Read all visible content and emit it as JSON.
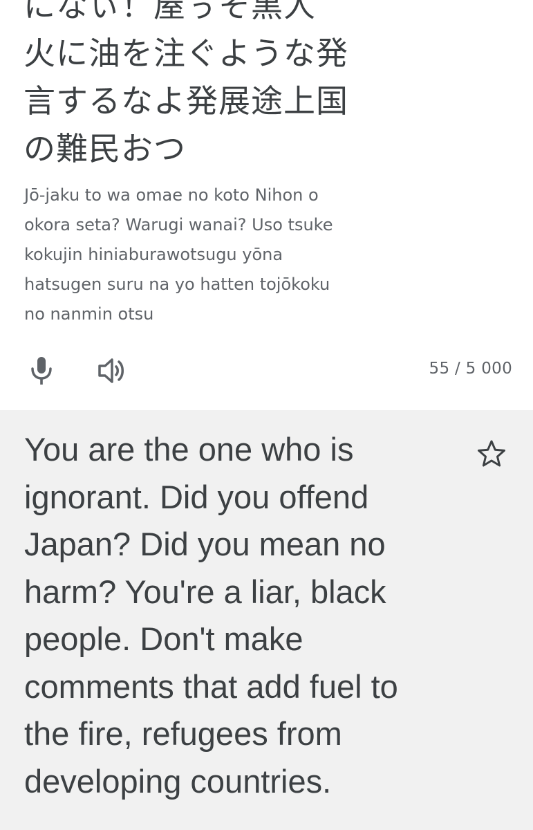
{
  "source": {
    "lines": [
      "になぃ！屋ぅそ黒人",
      "火に油を注ぐような発",
      "言するなよ発展途上国",
      "の難民おつ"
    ],
    "romanization_lines": [
      "Jō-jaku to wa omae no koto Nihon o",
      "okora seta? Warugi wanai? Uso tsuke",
      "kokujin hiniaburawotsugu yōna",
      "hatsugen suru na yo hatten tojōkoku",
      "no nanmin otsu"
    ],
    "char_count": "55 / 5 000",
    "icons": {
      "mic": "mic-icon",
      "speaker": "speaker-icon"
    }
  },
  "translation": {
    "lines": [
      "You are the one who is",
      "ignorant. Did you offend",
      "Japan? Did you mean no",
      "harm? You're a liar, black",
      "people. Don't make",
      "comments that add fuel to",
      "the fire, refugees from",
      "developing countries."
    ],
    "star_icon": "star-outline-icon"
  },
  "colors": {
    "text_primary": "#3c4043",
    "text_secondary": "#5f6368",
    "translation_bg": "#f1f1f1",
    "icon": "#5f6368"
  }
}
